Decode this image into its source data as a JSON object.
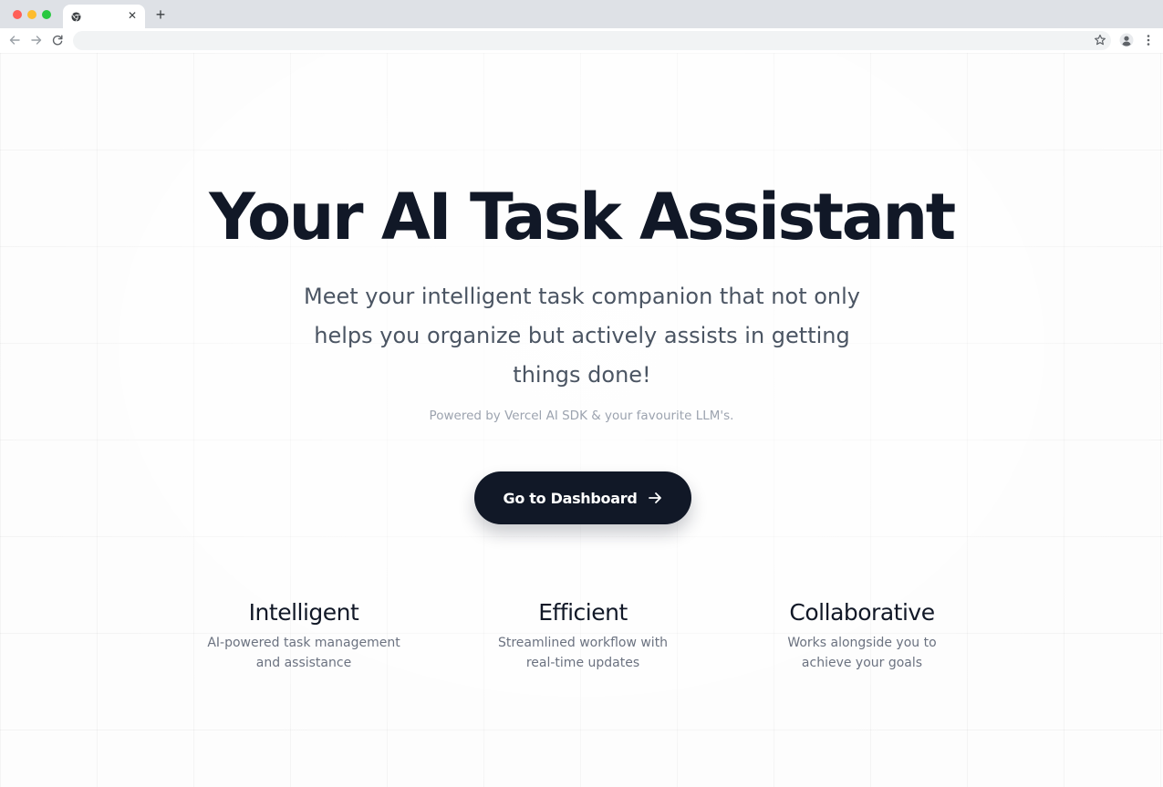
{
  "browser": {
    "tab_close_glyph": "✕",
    "new_tab_glyph": "+",
    "address": {
      "value": "",
      "placeholder": ""
    },
    "icons": {
      "back": "arrow-left-icon",
      "forward": "arrow-right-icon",
      "reload": "reload-icon",
      "bookmark": "star-icon",
      "profile": "profile-icon",
      "menu": "kebab-menu-icon"
    },
    "colors": {
      "traffic_red": "#ff5f57",
      "traffic_yellow": "#febc2e",
      "traffic_green": "#28c840"
    }
  },
  "hero": {
    "title": "Your AI Task Assistant",
    "subtitle": "Meet your intelligent task companion that not only helps you organize but actively assists in getting things done!",
    "powered_by": "Powered by Vercel AI SDK & your favourite LLM's.",
    "cta_label": "Go to Dashboard",
    "cta_icon": "arrow-right-icon"
  },
  "features": [
    {
      "title": "Intelligent",
      "description": "AI-powered task management and assistance"
    },
    {
      "title": "Efficient",
      "description": "Streamlined workflow with real-time updates"
    },
    {
      "title": "Collaborative",
      "description": "Works alongside you to achieve your goals"
    }
  ],
  "colors": {
    "heading": "#111827",
    "body_text": "#4b5563",
    "muted_text": "#9ca3af",
    "button_bg": "#111827",
    "button_text": "#ffffff"
  }
}
